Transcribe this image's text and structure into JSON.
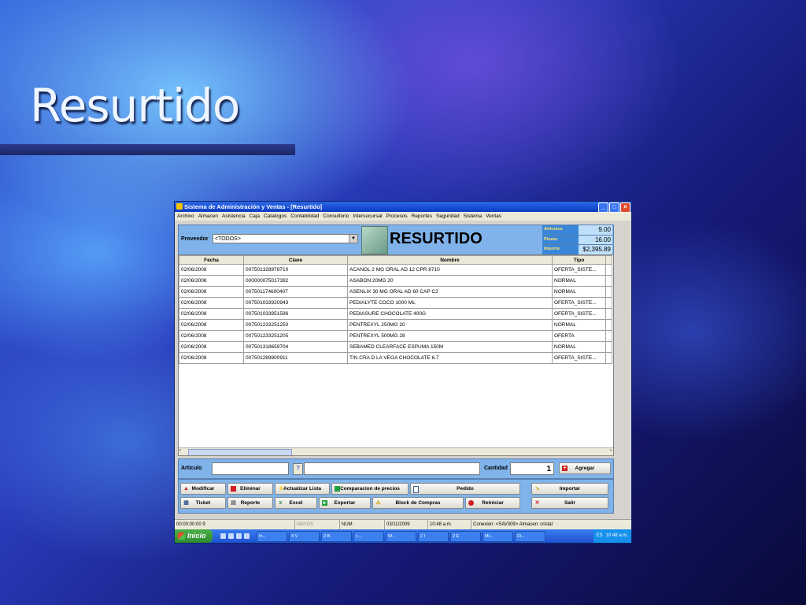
{
  "slide": {
    "title": "Resurtido"
  },
  "window": {
    "title": "Sistema de Administración y Ventas - [Resurtido]",
    "menu": [
      "Archivo",
      "Almacen",
      "Asistencia",
      "Caja",
      "Catalogos",
      "Contabilidad",
      "Consultorio",
      "Intersucursal",
      "Procesos",
      "Reportes",
      "Seguridad",
      "Sistema",
      "Ventas"
    ]
  },
  "header": {
    "proveedor_label": "Proveedor",
    "proveedor_value": "<TODOS>",
    "title": "RESURTIDO",
    "stats": [
      {
        "label": "Articulos",
        "value": "9.00"
      },
      {
        "label": "Piezas",
        "value": "16.00"
      },
      {
        "label": "Importe Estimado",
        "value": "$2,395.89"
      }
    ]
  },
  "table": {
    "columns": [
      "Fecha",
      "Clave",
      "Nombre",
      "Tipo"
    ],
    "rows": [
      [
        "02/06/2008",
        "007501328978710",
        "ACANOL 2 MG ORAL AD 12 CPR   8710",
        "OFERTA_SISTE..."
      ],
      [
        "02/06/2008",
        "000000075017392",
        "ASABON 20MG    20",
        "NORMAL"
      ],
      [
        "02/06/2008",
        "007501174600407",
        "ASENLIX 30 MG ORAL AD 60 CAP    C2",
        "NORMAL"
      ],
      [
        "02/06/2008",
        "007501033920943",
        "PEDIALYTE COCO 1000 ML",
        "OFERTA_SISTE..."
      ],
      [
        "02/06/2008",
        "007501033951596",
        "PEDIASURE CHOCOLATE    400G",
        "OFERTA_SISTE..."
      ],
      [
        "02/06/2008",
        "007501233251250",
        "PENTREXYL 250MG    20",
        "NORMAL"
      ],
      [
        "02/06/2008",
        "007501233251205",
        "PENTREXYL 500MG    28",
        "OFERTA"
      ],
      [
        "02/06/2008",
        "007501318659704",
        "SEBAMED CLEARFACE ESPUMA    150M",
        "NORMAL"
      ],
      [
        "02/06/2008",
        "007501289900911",
        "TIN CRA D LA VEGA CHOCOLATE 6.7",
        "OFERTA_SISTE..."
      ]
    ]
  },
  "entry": {
    "articulo_label": "Articulo",
    "cantidad_label": "Cantidad",
    "cantidad_value": "1",
    "agregar_label": "Agregar"
  },
  "buttons": {
    "modificar": "Modificar",
    "eliminar": "Eliminar",
    "actualizar": "Actualizar Lista",
    "comparacion": "Comparacion de precios",
    "pedido": "Pedido",
    "importar": "Importar",
    "ticket": "Ticket",
    "reporte": "Reporte",
    "excel": "Excel",
    "exportar": "Exportar",
    "block": "Block de Compras",
    "reiniciar": "Reiniciar",
    "salir": "Salir"
  },
  "status": {
    "time": "00:00:00:00 9",
    "mayus": "MAYÚS",
    "num": "NUM",
    "date": "03/11/2009",
    "clock": "10:48 a.m.",
    "conexion": "Conexion: <SAV309> Almacen: cristal"
  },
  "taskbar": {
    "start": "Inicio",
    "tasks": [
      "In...",
      "4 V",
      "2 B",
      "c...",
      "W...",
      "2 I",
      "2 E",
      "Mi...",
      "Di..."
    ],
    "lang": "ES",
    "clock": "10:48 a.m."
  }
}
